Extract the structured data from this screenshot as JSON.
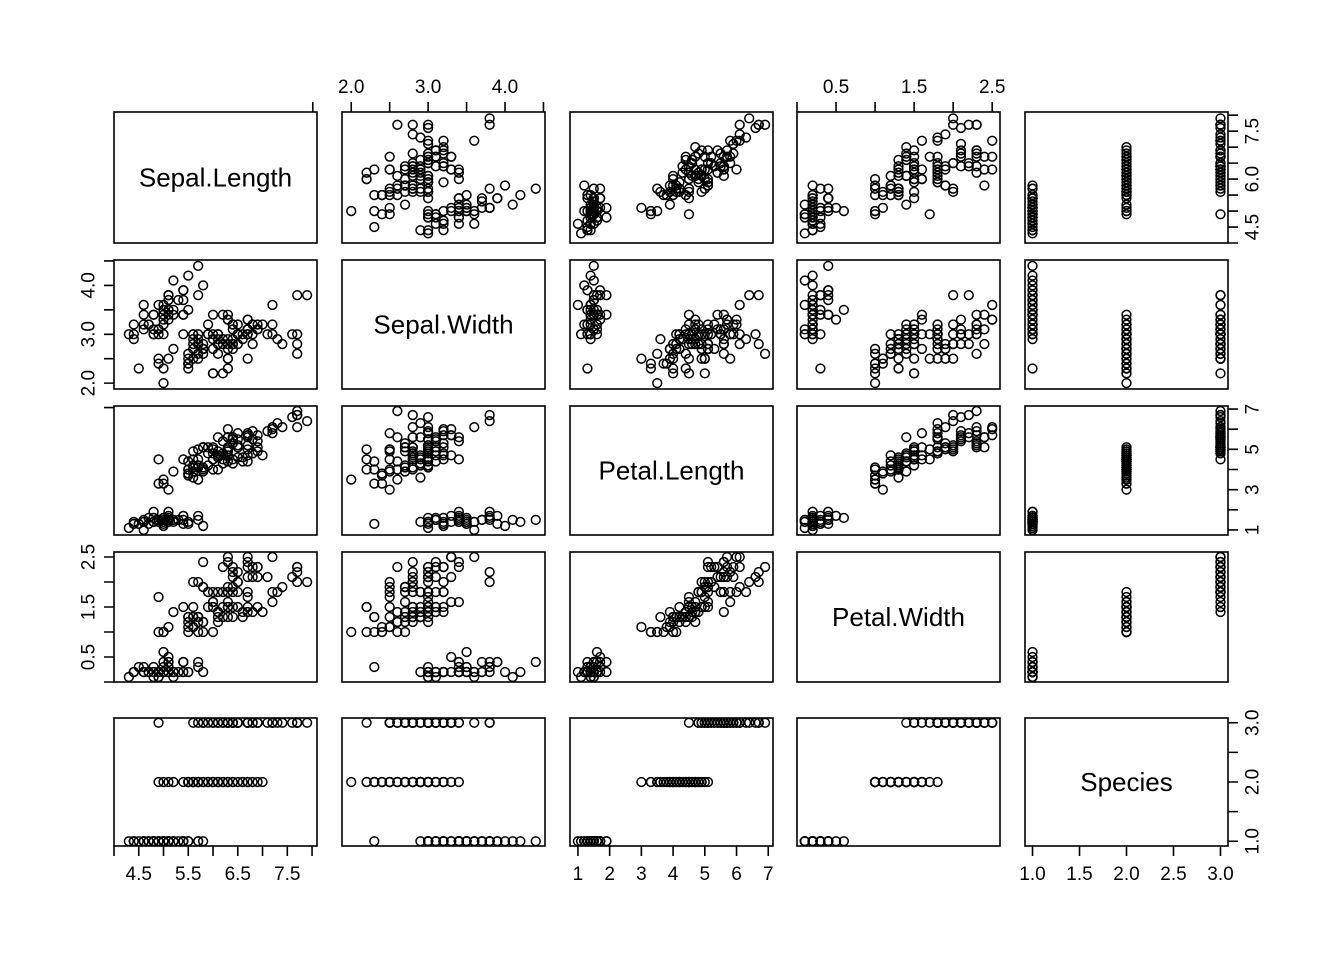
{
  "figure": {
    "type": "scatterplot-matrix",
    "title": "",
    "background_color": "#ffffff",
    "foreground_color": "#000000",
    "point_symbol": "open-circle",
    "point_radius_px": 4.4,
    "variables": [
      "Sepal.Length",
      "Sepal.Width",
      "Petal.Length",
      "Petal.Width",
      "Species"
    ],
    "n_observations": 150
  },
  "diagonal_labels": [
    "Sepal.Length",
    "Sepal.Width",
    "Petal.Length",
    "Petal.Width",
    "Species"
  ],
  "axes": {
    "Sepal.Length": {
      "ticks": [
        4.5,
        5.5,
        6.5,
        7.5
      ],
      "tick_labels": [
        "4.5",
        "5.5",
        "6.5",
        "7.5"
      ],
      "minor_ticks": [
        4.0,
        5.0,
        6.0,
        7.0,
        8.0
      ],
      "side_ticks": [
        4.5,
        6.0,
        7.5
      ],
      "side_tick_labels": [
        "4.5",
        "6.0",
        "7.5"
      ],
      "side_minor_ticks": [
        4.0,
        5.0,
        5.5,
        6.5,
        7.0,
        8.0
      ],
      "limits": [
        4.0,
        8.1
      ]
    },
    "Sepal.Width": {
      "ticks": [
        2.0,
        3.0,
        4.0
      ],
      "tick_labels": [
        "2.0",
        "3.0",
        "4.0"
      ],
      "minor_ticks": [
        1.5,
        2.5,
        3.5,
        4.5
      ],
      "side_ticks": [
        2.0,
        3.0,
        4.0
      ],
      "side_tick_labels": [
        "2.0",
        "3.0",
        "4.0"
      ],
      "side_minor_ticks": [
        1.5,
        2.5,
        3.5,
        4.5
      ],
      "limits": [
        1.88,
        4.52
      ]
    },
    "Petal.Length": {
      "ticks": [
        1,
        2,
        3,
        4,
        5,
        6,
        7
      ],
      "tick_labels": [
        "1",
        "2",
        "3",
        "4",
        "5",
        "6",
        "7"
      ],
      "minor_ticks": [],
      "side_ticks": [
        1,
        3,
        5,
        7
      ],
      "side_tick_labels": [
        "1",
        "3",
        "5",
        "7"
      ],
      "side_minor_ticks": [
        2,
        4,
        6
      ],
      "limits": [
        0.75,
        7.15
      ]
    },
    "Petal.Width": {
      "ticks": [
        0.5,
        1.5,
        2.5
      ],
      "tick_labels": [
        "0.5",
        "1.5",
        "2.5"
      ],
      "minor_ticks": [
        0.0,
        1.0,
        2.0
      ],
      "side_ticks": [
        0.5,
        1.5,
        2.5
      ],
      "side_tick_labels": [
        "0.5",
        "1.5",
        "2.5"
      ],
      "side_minor_ticks": [
        0.0,
        1.0,
        2.0
      ],
      "limits": [
        0.0,
        2.6
      ]
    },
    "Species": {
      "ticks": [
        1.0,
        1.5,
        2.0,
        2.5,
        3.0
      ],
      "tick_labels": [
        "1.0",
        "1.5",
        "2.0",
        "2.5",
        "3.0"
      ],
      "minor_ticks": [],
      "side_ticks": [
        1.0,
        2.0,
        3.0
      ],
      "side_tick_labels": [
        "1.0",
        "2.0",
        "3.0"
      ],
      "side_minor_ticks": [
        1.5,
        2.5
      ],
      "limits": [
        0.92,
        3.08
      ]
    }
  },
  "axis_placement": {
    "note": "Alternating R pairs() style: top ticks on even columns, bottom ticks on odd columns, left ticks on even rows, right ticks on odd rows.",
    "top_labeled_columns": [
      2,
      4
    ],
    "bottom_labeled_columns": [
      1,
      3,
      5
    ],
    "left_labeled_rows": [
      2,
      4
    ],
    "right_labeled_rows": [
      1,
      3,
      5
    ]
  },
  "chart_data": {
    "type": "scatter",
    "title": "",
    "xlabel": "",
    "ylabel": "",
    "variables": [
      "Sepal.Length",
      "Sepal.Width",
      "Petal.Length",
      "Petal.Width",
      "Species"
    ],
    "species_codes": {
      "setosa": 1,
      "versicolor": 2,
      "virginica": 3
    },
    "rows": [
      [
        5.1,
        3.5,
        1.4,
        0.2,
        1
      ],
      [
        4.9,
        3.0,
        1.4,
        0.2,
        1
      ],
      [
        4.7,
        3.2,
        1.3,
        0.2,
        1
      ],
      [
        4.6,
        3.1,
        1.5,
        0.2,
        1
      ],
      [
        5.0,
        3.6,
        1.4,
        0.2,
        1
      ],
      [
        5.4,
        3.9,
        1.7,
        0.4,
        1
      ],
      [
        4.6,
        3.4,
        1.4,
        0.3,
        1
      ],
      [
        5.0,
        3.4,
        1.5,
        0.2,
        1
      ],
      [
        4.4,
        2.9,
        1.4,
        0.2,
        1
      ],
      [
        4.9,
        3.1,
        1.5,
        0.1,
        1
      ],
      [
        5.4,
        3.7,
        1.5,
        0.2,
        1
      ],
      [
        4.8,
        3.4,
        1.6,
        0.2,
        1
      ],
      [
        4.8,
        3.0,
        1.4,
        0.1,
        1
      ],
      [
        4.3,
        3.0,
        1.1,
        0.1,
        1
      ],
      [
        5.8,
        4.0,
        1.2,
        0.2,
        1
      ],
      [
        5.7,
        4.4,
        1.5,
        0.4,
        1
      ],
      [
        5.4,
        3.9,
        1.3,
        0.4,
        1
      ],
      [
        5.1,
        3.5,
        1.4,
        0.3,
        1
      ],
      [
        5.7,
        3.8,
        1.7,
        0.3,
        1
      ],
      [
        5.1,
        3.8,
        1.5,
        0.3,
        1
      ],
      [
        5.4,
        3.4,
        1.7,
        0.2,
        1
      ],
      [
        5.1,
        3.7,
        1.5,
        0.4,
        1
      ],
      [
        4.6,
        3.6,
        1.0,
        0.2,
        1
      ],
      [
        5.1,
        3.3,
        1.7,
        0.5,
        1
      ],
      [
        4.8,
        3.4,
        1.9,
        0.2,
        1
      ],
      [
        5.0,
        3.0,
        1.6,
        0.2,
        1
      ],
      [
        5.0,
        3.4,
        1.6,
        0.4,
        1
      ],
      [
        5.2,
        3.5,
        1.5,
        0.2,
        1
      ],
      [
        5.2,
        3.4,
        1.4,
        0.2,
        1
      ],
      [
        4.7,
        3.2,
        1.6,
        0.2,
        1
      ],
      [
        4.8,
        3.1,
        1.6,
        0.2,
        1
      ],
      [
        5.4,
        3.4,
        1.5,
        0.4,
        1
      ],
      [
        5.2,
        4.1,
        1.5,
        0.1,
        1
      ],
      [
        5.5,
        4.2,
        1.4,
        0.2,
        1
      ],
      [
        4.9,
        3.1,
        1.5,
        0.2,
        1
      ],
      [
        5.0,
        3.2,
        1.2,
        0.2,
        1
      ],
      [
        5.5,
        3.5,
        1.3,
        0.2,
        1
      ],
      [
        4.9,
        3.6,
        1.4,
        0.1,
        1
      ],
      [
        4.4,
        3.0,
        1.3,
        0.2,
        1
      ],
      [
        5.1,
        3.4,
        1.5,
        0.2,
        1
      ],
      [
        5.0,
        3.5,
        1.3,
        0.3,
        1
      ],
      [
        4.5,
        2.3,
        1.3,
        0.3,
        1
      ],
      [
        4.4,
        3.2,
        1.3,
        0.2,
        1
      ],
      [
        5.0,
        3.5,
        1.6,
        0.6,
        1
      ],
      [
        5.1,
        3.8,
        1.9,
        0.4,
        1
      ],
      [
        4.8,
        3.0,
        1.4,
        0.3,
        1
      ],
      [
        5.1,
        3.8,
        1.6,
        0.2,
        1
      ],
      [
        4.6,
        3.2,
        1.4,
        0.2,
        1
      ],
      [
        5.3,
        3.7,
        1.5,
        0.2,
        1
      ],
      [
        5.0,
        3.3,
        1.4,
        0.2,
        1
      ],
      [
        7.0,
        3.2,
        4.7,
        1.4,
        2
      ],
      [
        6.4,
        3.2,
        4.5,
        1.5,
        2
      ],
      [
        6.9,
        3.1,
        4.9,
        1.5,
        2
      ],
      [
        5.5,
        2.3,
        4.0,
        1.3,
        2
      ],
      [
        6.5,
        2.8,
        4.6,
        1.5,
        2
      ],
      [
        5.7,
        2.8,
        4.5,
        1.3,
        2
      ],
      [
        6.3,
        3.3,
        4.7,
        1.6,
        2
      ],
      [
        4.9,
        2.4,
        3.3,
        1.0,
        2
      ],
      [
        6.6,
        2.9,
        4.6,
        1.3,
        2
      ],
      [
        5.2,
        2.7,
        3.9,
        1.4,
        2
      ],
      [
        5.0,
        2.0,
        3.5,
        1.0,
        2
      ],
      [
        5.9,
        3.0,
        4.2,
        1.5,
        2
      ],
      [
        6.0,
        2.2,
        4.0,
        1.0,
        2
      ],
      [
        6.1,
        2.9,
        4.7,
        1.4,
        2
      ],
      [
        5.6,
        2.9,
        3.6,
        1.3,
        2
      ],
      [
        6.7,
        3.1,
        4.4,
        1.4,
        2
      ],
      [
        5.6,
        3.0,
        4.5,
        1.5,
        2
      ],
      [
        5.8,
        2.7,
        4.1,
        1.0,
        2
      ],
      [
        6.2,
        2.2,
        4.5,
        1.5,
        2
      ],
      [
        5.6,
        2.5,
        3.9,
        1.1,
        2
      ],
      [
        5.9,
        3.2,
        4.8,
        1.8,
        2
      ],
      [
        6.1,
        2.8,
        4.0,
        1.3,
        2
      ],
      [
        6.3,
        2.5,
        4.9,
        1.5,
        2
      ],
      [
        6.1,
        2.8,
        4.7,
        1.2,
        2
      ],
      [
        6.4,
        2.9,
        4.3,
        1.3,
        2
      ],
      [
        6.6,
        3.0,
        4.4,
        1.4,
        2
      ],
      [
        6.8,
        2.8,
        4.8,
        1.4,
        2
      ],
      [
        6.7,
        3.0,
        5.0,
        1.7,
        2
      ],
      [
        6.0,
        2.9,
        4.5,
        1.5,
        2
      ],
      [
        5.7,
        2.6,
        3.5,
        1.0,
        2
      ],
      [
        5.5,
        2.4,
        3.8,
        1.1,
        2
      ],
      [
        5.5,
        2.4,
        3.7,
        1.0,
        2
      ],
      [
        5.8,
        2.7,
        3.9,
        1.2,
        2
      ],
      [
        6.0,
        2.7,
        5.1,
        1.6,
        2
      ],
      [
        5.4,
        3.0,
        4.5,
        1.5,
        2
      ],
      [
        6.0,
        3.4,
        4.5,
        1.6,
        2
      ],
      [
        6.7,
        3.1,
        4.7,
        1.5,
        2
      ],
      [
        6.3,
        2.3,
        4.4,
        1.3,
        2
      ],
      [
        5.6,
        3.0,
        4.1,
        1.3,
        2
      ],
      [
        5.5,
        2.5,
        4.0,
        1.3,
        2
      ],
      [
        5.5,
        2.6,
        4.4,
        1.2,
        2
      ],
      [
        6.1,
        3.0,
        4.6,
        1.4,
        2
      ],
      [
        5.8,
        2.6,
        4.0,
        1.2,
        2
      ],
      [
        5.0,
        2.3,
        3.3,
        1.0,
        2
      ],
      [
        5.6,
        2.7,
        4.2,
        1.3,
        2
      ],
      [
        5.7,
        3.0,
        4.2,
        1.2,
        2
      ],
      [
        5.7,
        2.9,
        4.2,
        1.3,
        2
      ],
      [
        6.2,
        2.9,
        4.3,
        1.3,
        2
      ],
      [
        5.1,
        2.5,
        3.0,
        1.1,
        2
      ],
      [
        5.7,
        2.8,
        4.1,
        1.3,
        2
      ],
      [
        6.3,
        3.3,
        6.0,
        2.5,
        3
      ],
      [
        5.8,
        2.7,
        5.1,
        1.9,
        3
      ],
      [
        7.1,
        3.0,
        5.9,
        2.1,
        3
      ],
      [
        6.3,
        2.9,
        5.6,
        1.8,
        3
      ],
      [
        6.5,
        3.0,
        5.8,
        2.2,
        3
      ],
      [
        7.6,
        3.0,
        6.6,
        2.1,
        3
      ],
      [
        4.9,
        2.5,
        4.5,
        1.7,
        3
      ],
      [
        7.3,
        2.9,
        6.3,
        1.8,
        3
      ],
      [
        6.7,
        2.5,
        5.8,
        1.8,
        3
      ],
      [
        7.2,
        3.6,
        6.1,
        2.5,
        3
      ],
      [
        6.5,
        3.2,
        5.1,
        2.0,
        3
      ],
      [
        6.4,
        2.7,
        5.3,
        1.9,
        3
      ],
      [
        6.8,
        3.0,
        5.5,
        2.1,
        3
      ],
      [
        5.7,
        2.5,
        5.0,
        2.0,
        3
      ],
      [
        5.8,
        2.8,
        5.1,
        2.4,
        3
      ],
      [
        6.4,
        3.2,
        5.3,
        2.3,
        3
      ],
      [
        6.5,
        3.0,
        5.5,
        1.8,
        3
      ],
      [
        7.7,
        3.8,
        6.7,
        2.2,
        3
      ],
      [
        7.7,
        2.6,
        6.9,
        2.3,
        3
      ],
      [
        6.0,
        2.2,
        5.0,
        1.5,
        3
      ],
      [
        6.9,
        3.2,
        5.7,
        2.3,
        3
      ],
      [
        5.6,
        2.8,
        4.9,
        2.0,
        3
      ],
      [
        7.7,
        2.8,
        6.7,
        2.0,
        3
      ],
      [
        6.3,
        2.7,
        4.9,
        1.8,
        3
      ],
      [
        6.7,
        3.3,
        5.7,
        2.1,
        3
      ],
      [
        7.2,
        3.2,
        6.0,
        1.8,
        3
      ],
      [
        6.2,
        2.8,
        4.8,
        1.8,
        3
      ],
      [
        6.1,
        3.0,
        4.9,
        1.8,
        3
      ],
      [
        6.4,
        2.8,
        5.6,
        2.1,
        3
      ],
      [
        7.2,
        3.0,
        5.8,
        1.6,
        3
      ],
      [
        7.4,
        2.8,
        6.1,
        1.9,
        3
      ],
      [
        7.9,
        3.8,
        6.4,
        2.0,
        3
      ],
      [
        6.4,
        2.8,
        5.6,
        2.2,
        3
      ],
      [
        6.3,
        2.8,
        5.1,
        1.5,
        3
      ],
      [
        6.1,
        2.6,
        5.6,
        1.4,
        3
      ],
      [
        7.7,
        3.0,
        6.1,
        2.3,
        3
      ],
      [
        6.3,
        3.4,
        5.6,
        2.4,
        3
      ],
      [
        6.4,
        3.1,
        5.5,
        1.8,
        3
      ],
      [
        6.0,
        3.0,
        4.8,
        1.8,
        3
      ],
      [
        6.9,
        3.1,
        5.4,
        2.1,
        3
      ],
      [
        6.7,
        3.1,
        5.6,
        2.4,
        3
      ],
      [
        6.9,
        3.1,
        5.1,
        2.3,
        3
      ],
      [
        5.8,
        2.7,
        5.1,
        1.9,
        3
      ],
      [
        6.8,
        3.2,
        5.9,
        2.3,
        3
      ],
      [
        6.7,
        3.3,
        5.7,
        2.5,
        3
      ],
      [
        6.7,
        3.0,
        5.2,
        2.3,
        3
      ],
      [
        6.3,
        2.5,
        5.0,
        1.9,
        3
      ],
      [
        6.5,
        3.0,
        5.2,
        2.0,
        3
      ],
      [
        6.2,
        3.4,
        5.4,
        2.3,
        3
      ],
      [
        5.9,
        3.0,
        5.1,
        1.8,
        3
      ]
    ]
  },
  "layout": {
    "panel_left_edges": [
      114,
      342,
      570,
      797,
      1025
    ],
    "panel_right_edges": [
      317,
      545,
      773,
      1000,
      1228
    ],
    "panel_top_edges": [
      112,
      260,
      406,
      552,
      718
    ],
    "panel_bottom_edges": [
      243,
      389,
      535,
      682,
      846
    ]
  }
}
